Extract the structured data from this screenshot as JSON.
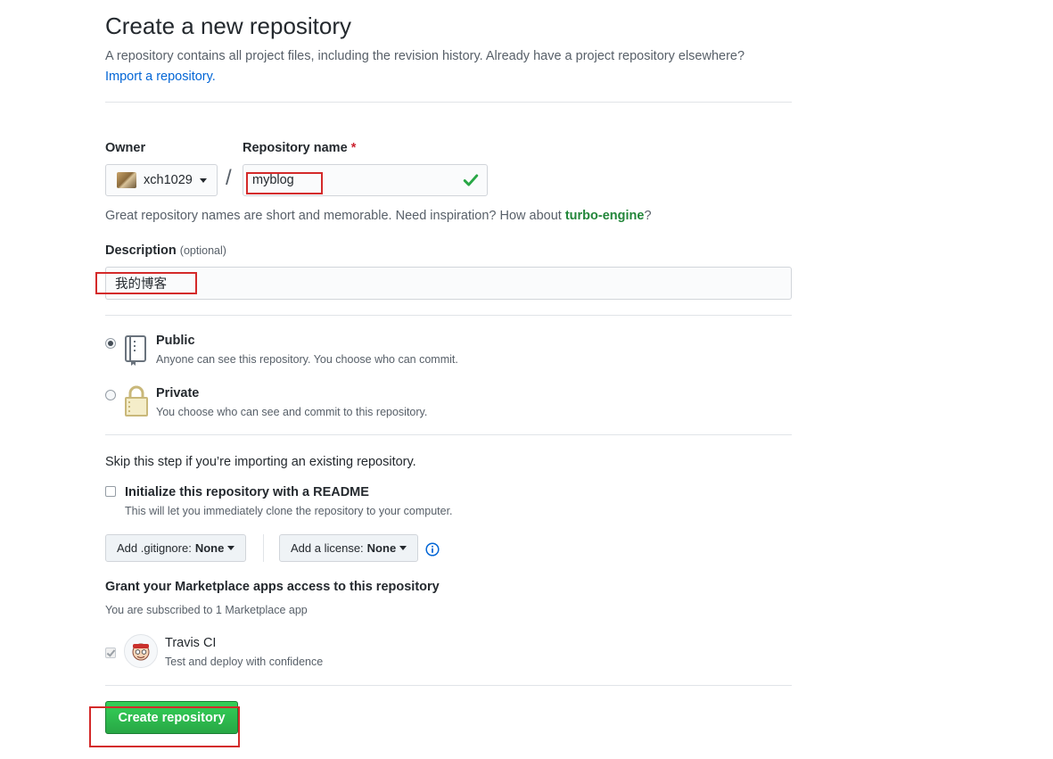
{
  "header": {
    "title": "Create a new repository",
    "subtitle": "A repository contains all project files, including the revision history. Already have a project repository elsewhere?",
    "import_link": "Import a repository."
  },
  "owner": {
    "label": "Owner",
    "value": "xch1029"
  },
  "repo_name": {
    "label": "Repository name",
    "required_mark": "*",
    "value": "myblog"
  },
  "hint": {
    "prefix": "Great repository names are short and memorable. Need inspiration? How about ",
    "suggestion": "turbo-engine",
    "suffix": "?"
  },
  "description": {
    "label": "Description",
    "optional": "(optional)",
    "value": "我的博客"
  },
  "visibility": {
    "public": {
      "title": "Public",
      "note": "Anyone can see this repository. You choose who can commit.",
      "selected": true
    },
    "private": {
      "title": "Private",
      "note": "You choose who can see and commit to this repository.",
      "selected": false
    }
  },
  "init": {
    "skip_text": "Skip this step if you’re importing an existing repository.",
    "readme_label": "Initialize this repository with a README",
    "readme_note": "This will let you immediately clone the repository to your computer."
  },
  "selects": {
    "gitignore_label": "Add .gitignore:",
    "gitignore_value": "None",
    "license_label": "Add a license:",
    "license_value": "None"
  },
  "marketplace": {
    "title": "Grant your Marketplace apps access to this repository",
    "note": "You are subscribed to 1 Marketplace app",
    "app_name": "Travis CI",
    "app_desc": "Test and deploy with confidence"
  },
  "submit": {
    "label": "Create repository"
  },
  "colors": {
    "accent_green": "#28a745",
    "link_blue": "#0366d6",
    "annotation_red": "#d42a2a"
  }
}
